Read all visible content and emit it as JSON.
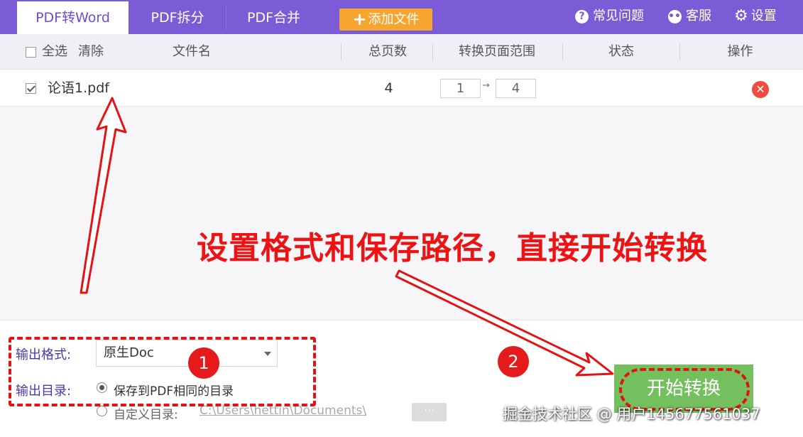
{
  "tabs": [
    {
      "label": "PDF转Word",
      "active": true
    },
    {
      "label": "PDF拆分",
      "active": false
    },
    {
      "label": "PDF合并",
      "active": false
    }
  ],
  "toolbar": {
    "add_file_label": "添加文件",
    "faq_label": "常见问题",
    "support_label": "客服",
    "settings_label": "设置"
  },
  "table": {
    "select_all_label": "全选",
    "clear_label": "清除",
    "headers": {
      "filename": "文件名",
      "total_pages": "总页数",
      "page_range": "转换页面范围",
      "status": "状态",
      "action": "操作"
    },
    "rows": [
      {
        "checked": true,
        "filename": "论语1.pdf",
        "total_pages": "4",
        "range_from": "1",
        "range_to": "4",
        "status": ""
      }
    ]
  },
  "output": {
    "format_label": "输出格式:",
    "format_value": "原生Doc",
    "dir_label": "输出目录:",
    "option_same_dir": "保存到PDF相同的目录",
    "option_custom_dir": "自定义目录:",
    "custom_dir_path": "C:\\Users\\hettin\\Documents\\",
    "browse_label": "···"
  },
  "start_button_label": "开始转换",
  "annotations": {
    "callout_text": "设置格式和保存路径，直接开始转换",
    "step1": "1",
    "step2": "2",
    "arrow_color": "#e51212"
  },
  "watermark": "掘金技术社区 @ 用户145677561037",
  "colors": {
    "brand_purple": "#7b5cd6",
    "add_orange": "#f7a531",
    "start_green": "#74c05f",
    "delete_red": "#ef4b3f"
  }
}
